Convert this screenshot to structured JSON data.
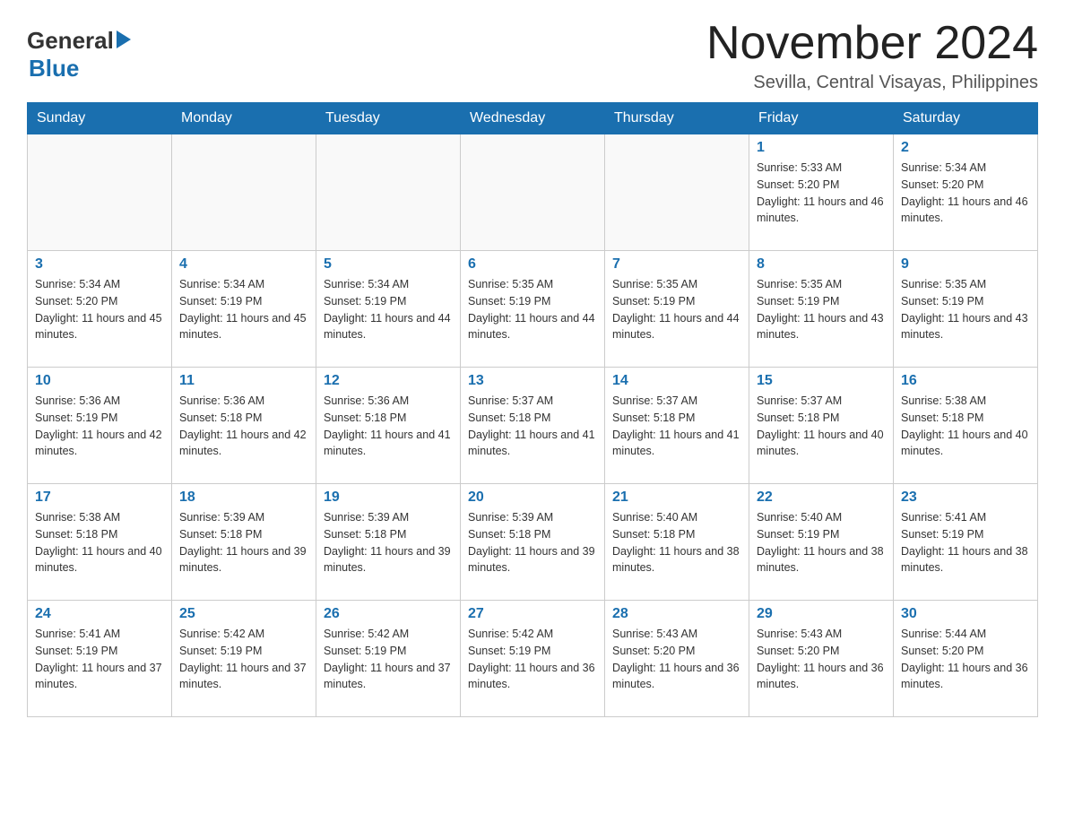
{
  "header": {
    "logo_general": "General",
    "logo_blue": "Blue",
    "month_title": "November 2024",
    "location": "Sevilla, Central Visayas, Philippines"
  },
  "days_of_week": [
    "Sunday",
    "Monday",
    "Tuesday",
    "Wednesday",
    "Thursday",
    "Friday",
    "Saturday"
  ],
  "weeks": [
    [
      {
        "day": "",
        "info": ""
      },
      {
        "day": "",
        "info": ""
      },
      {
        "day": "",
        "info": ""
      },
      {
        "day": "",
        "info": ""
      },
      {
        "day": "",
        "info": ""
      },
      {
        "day": "1",
        "info": "Sunrise: 5:33 AM\nSunset: 5:20 PM\nDaylight: 11 hours and 46 minutes."
      },
      {
        "day": "2",
        "info": "Sunrise: 5:34 AM\nSunset: 5:20 PM\nDaylight: 11 hours and 46 minutes."
      }
    ],
    [
      {
        "day": "3",
        "info": "Sunrise: 5:34 AM\nSunset: 5:20 PM\nDaylight: 11 hours and 45 minutes."
      },
      {
        "day": "4",
        "info": "Sunrise: 5:34 AM\nSunset: 5:19 PM\nDaylight: 11 hours and 45 minutes."
      },
      {
        "day": "5",
        "info": "Sunrise: 5:34 AM\nSunset: 5:19 PM\nDaylight: 11 hours and 44 minutes."
      },
      {
        "day": "6",
        "info": "Sunrise: 5:35 AM\nSunset: 5:19 PM\nDaylight: 11 hours and 44 minutes."
      },
      {
        "day": "7",
        "info": "Sunrise: 5:35 AM\nSunset: 5:19 PM\nDaylight: 11 hours and 44 minutes."
      },
      {
        "day": "8",
        "info": "Sunrise: 5:35 AM\nSunset: 5:19 PM\nDaylight: 11 hours and 43 minutes."
      },
      {
        "day": "9",
        "info": "Sunrise: 5:35 AM\nSunset: 5:19 PM\nDaylight: 11 hours and 43 minutes."
      }
    ],
    [
      {
        "day": "10",
        "info": "Sunrise: 5:36 AM\nSunset: 5:19 PM\nDaylight: 11 hours and 42 minutes."
      },
      {
        "day": "11",
        "info": "Sunrise: 5:36 AM\nSunset: 5:18 PM\nDaylight: 11 hours and 42 minutes."
      },
      {
        "day": "12",
        "info": "Sunrise: 5:36 AM\nSunset: 5:18 PM\nDaylight: 11 hours and 41 minutes."
      },
      {
        "day": "13",
        "info": "Sunrise: 5:37 AM\nSunset: 5:18 PM\nDaylight: 11 hours and 41 minutes."
      },
      {
        "day": "14",
        "info": "Sunrise: 5:37 AM\nSunset: 5:18 PM\nDaylight: 11 hours and 41 minutes."
      },
      {
        "day": "15",
        "info": "Sunrise: 5:37 AM\nSunset: 5:18 PM\nDaylight: 11 hours and 40 minutes."
      },
      {
        "day": "16",
        "info": "Sunrise: 5:38 AM\nSunset: 5:18 PM\nDaylight: 11 hours and 40 minutes."
      }
    ],
    [
      {
        "day": "17",
        "info": "Sunrise: 5:38 AM\nSunset: 5:18 PM\nDaylight: 11 hours and 40 minutes."
      },
      {
        "day": "18",
        "info": "Sunrise: 5:39 AM\nSunset: 5:18 PM\nDaylight: 11 hours and 39 minutes."
      },
      {
        "day": "19",
        "info": "Sunrise: 5:39 AM\nSunset: 5:18 PM\nDaylight: 11 hours and 39 minutes."
      },
      {
        "day": "20",
        "info": "Sunrise: 5:39 AM\nSunset: 5:18 PM\nDaylight: 11 hours and 39 minutes."
      },
      {
        "day": "21",
        "info": "Sunrise: 5:40 AM\nSunset: 5:18 PM\nDaylight: 11 hours and 38 minutes."
      },
      {
        "day": "22",
        "info": "Sunrise: 5:40 AM\nSunset: 5:19 PM\nDaylight: 11 hours and 38 minutes."
      },
      {
        "day": "23",
        "info": "Sunrise: 5:41 AM\nSunset: 5:19 PM\nDaylight: 11 hours and 38 minutes."
      }
    ],
    [
      {
        "day": "24",
        "info": "Sunrise: 5:41 AM\nSunset: 5:19 PM\nDaylight: 11 hours and 37 minutes."
      },
      {
        "day": "25",
        "info": "Sunrise: 5:42 AM\nSunset: 5:19 PM\nDaylight: 11 hours and 37 minutes."
      },
      {
        "day": "26",
        "info": "Sunrise: 5:42 AM\nSunset: 5:19 PM\nDaylight: 11 hours and 37 minutes."
      },
      {
        "day": "27",
        "info": "Sunrise: 5:42 AM\nSunset: 5:19 PM\nDaylight: 11 hours and 36 minutes."
      },
      {
        "day": "28",
        "info": "Sunrise: 5:43 AM\nSunset: 5:20 PM\nDaylight: 11 hours and 36 minutes."
      },
      {
        "day": "29",
        "info": "Sunrise: 5:43 AM\nSunset: 5:20 PM\nDaylight: 11 hours and 36 minutes."
      },
      {
        "day": "30",
        "info": "Sunrise: 5:44 AM\nSunset: 5:20 PM\nDaylight: 11 hours and 36 minutes."
      }
    ]
  ]
}
